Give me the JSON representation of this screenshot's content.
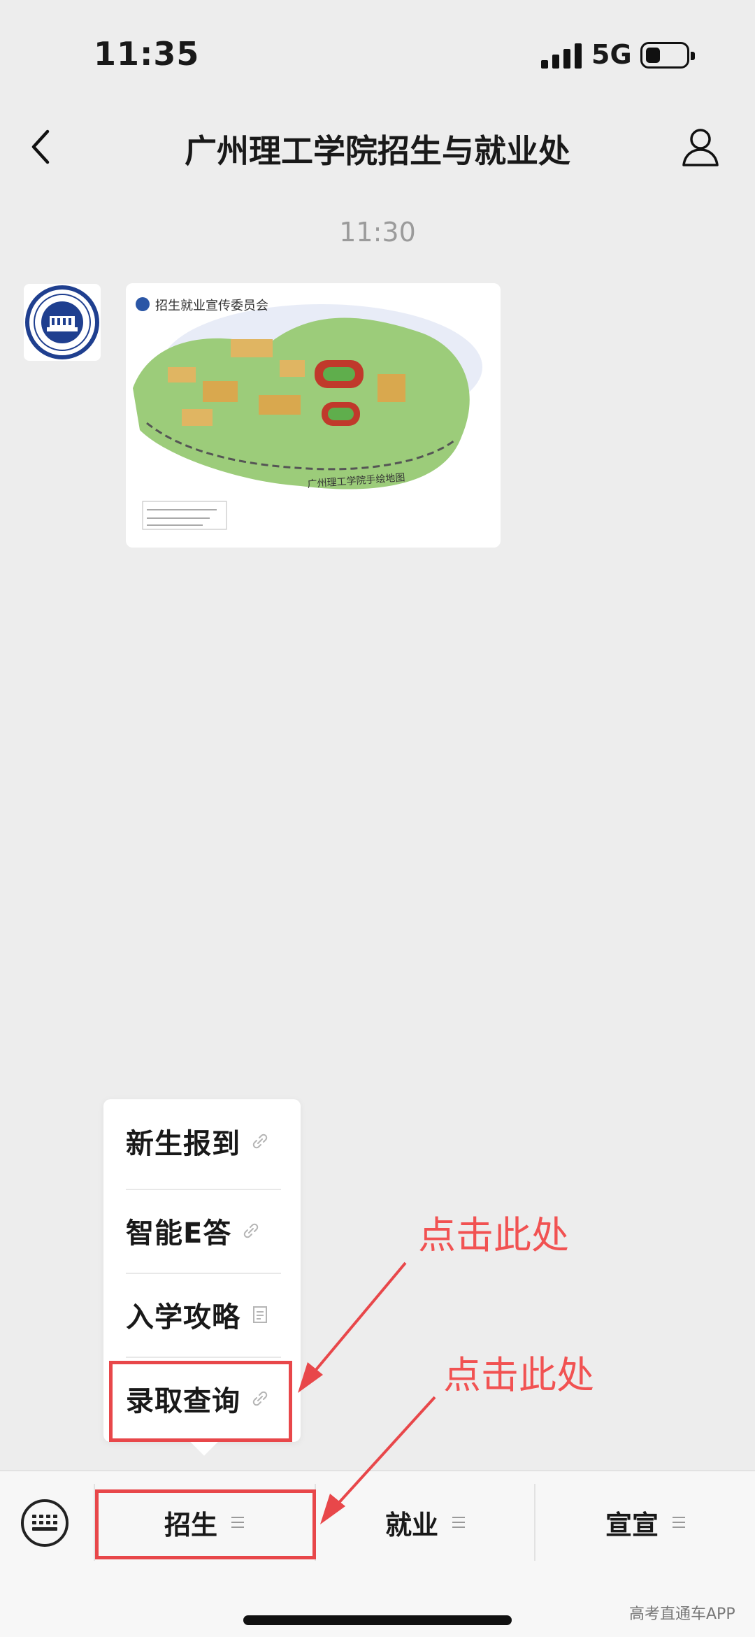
{
  "status_bar": {
    "time": "11:35",
    "network": "5G"
  },
  "nav": {
    "title": "广州理工学院招生与就业处"
  },
  "chat": {
    "timestamp": "11:30"
  },
  "message": {
    "map_header": "招生就业宣传委员会",
    "map_caption": "广州理工学院手绘地图"
  },
  "popup_menu": {
    "items": [
      {
        "label": "新生报到",
        "icon": "link-icon"
      },
      {
        "label": "智能E答",
        "icon": "link-icon"
      },
      {
        "label": "入学攻略",
        "icon": "article-icon"
      },
      {
        "label": "录取查询",
        "icon": "link-icon"
      }
    ]
  },
  "bottom_menu": {
    "tabs": [
      {
        "label": "招生"
      },
      {
        "label": "就业"
      },
      {
        "label": "宣宣"
      }
    ]
  },
  "annotations": {
    "hint_1": "点击此处",
    "hint_2": "点击此处"
  },
  "watermark": "高考直通车APP",
  "colors": {
    "annotation_red": "#e8474a",
    "background": "#ededed"
  }
}
